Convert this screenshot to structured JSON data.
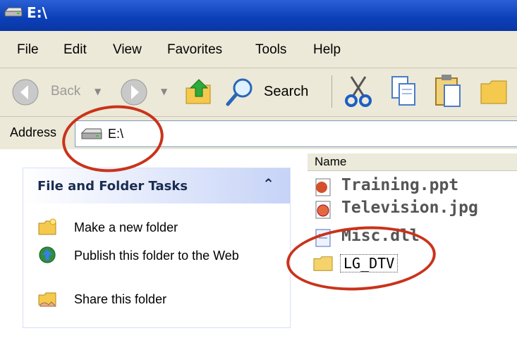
{
  "window": {
    "title": "E:\\",
    "icon": "drive-icon"
  },
  "menu": [
    "File",
    "Edit",
    "View",
    "Favorites",
    "Tools",
    "Help"
  ],
  "toolbar": {
    "back_label": "Back",
    "search_label": "Search"
  },
  "address": {
    "label": "Address",
    "value": "E:\\"
  },
  "tasks_panel": {
    "title": "File and Folder Tasks",
    "collapse_glyph": "«",
    "items": [
      {
        "label": "Make a new folder",
        "icon": "new-folder-icon"
      },
      {
        "label": "Publish this folder to the Web",
        "icon": "publish-web-icon"
      },
      {
        "label": "Share this folder",
        "icon": "share-folder-icon"
      }
    ]
  },
  "file_list": {
    "column": "Name",
    "files": [
      {
        "name": "Training.ppt",
        "icon": "ppt-file-icon"
      },
      {
        "name": "Television.jpg",
        "icon": "jpg-file-icon"
      },
      {
        "name": "Misc.dll",
        "icon": "dll-file-icon"
      },
      {
        "name": "LG_DTV",
        "icon": "folder-icon",
        "selected": true
      }
    ]
  },
  "colors": {
    "title_bar": "#0b3fb8",
    "chrome": "#ece9d8",
    "highlight_ring": "#c9331a"
  }
}
